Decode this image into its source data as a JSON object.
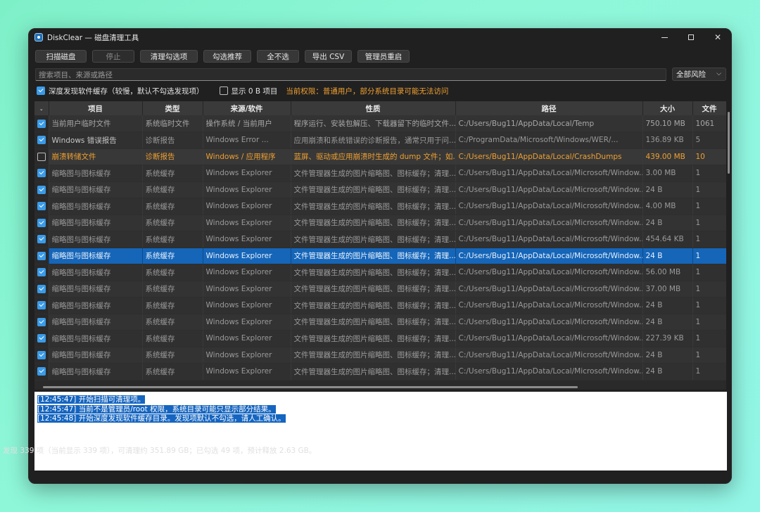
{
  "window": {
    "title": "DiskClear — 磁盘清理工具",
    "controls": {
      "minimize": "minimize-icon",
      "maximize": "maximize-icon",
      "close": "✕"
    }
  },
  "toolbar": {
    "scan": "扫描磁盘",
    "stop": "停止",
    "clean": "清理勾选项",
    "recommend": "勾选推荐",
    "clear_all": "全不选",
    "export_csv": "导出 CSV",
    "admin_restart": "管理员重启"
  },
  "search": {
    "placeholder": "搜索项目、来源或路径",
    "value": ""
  },
  "risk_filter": {
    "selected": "全部风险"
  },
  "options": {
    "deep_scan_label": "深度发现软件缓存（较慢，默认不勾选发现项）",
    "deep_scan_checked": true,
    "show_zero_label": "显示 0 B 项目",
    "show_zero_checked": false,
    "privilege_note": "当前权限：普通用户，部分系统目录可能无法访问"
  },
  "table": {
    "columns": [
      "项目",
      "类型",
      "来源/软件",
      "性质",
      "路径",
      "大小",
      "文件"
    ],
    "rows": [
      {
        "checked": true,
        "name": "当前用户临时文件",
        "type": "系统临时文件",
        "source": "操作系统 / 当前用户",
        "nature": "程序运行、安装包解压、下载器留下的临时文件...",
        "path": "C:/Users/Bug11/AppData/Local/Temp",
        "size": "750.10 MB",
        "files": "1061"
      },
      {
        "checked": true,
        "name": "Windows 错误报告",
        "type": "诊断报告",
        "source": "Windows Error ...",
        "nature": "应用崩溃和系统错误的诊断报告，通常只用于问...",
        "path": "C:/ProgramData/Microsoft/Windows/WER/...",
        "size": "136.89 KB",
        "files": "5"
      },
      {
        "checked": false,
        "name": "崩溃转储文件",
        "type": "诊断报告",
        "source": "Windows / 应用程序",
        "nature": "蓝屏、驱动或应用崩溃时生成的 dump 文件；如...",
        "path": "C:/Users/Bug11/AppData/Local/CrashDumps",
        "size": "439.00 MB",
        "files": "10"
      },
      {
        "checked": true,
        "name": "缩略图与图标缓存",
        "type": "系统缓存",
        "source": "Windows Explorer",
        "nature": "文件管理器生成的图片缩略图、图标缓存；清理...",
        "path": "C:/Users/Bug11/AppData/Local/Microsoft/Window...",
        "size": "3.00 MB",
        "files": "1"
      },
      {
        "checked": true,
        "name": "缩略图与图标缓存",
        "type": "系统缓存",
        "source": "Windows Explorer",
        "nature": "文件管理器生成的图片缩略图、图标缓存；清理...",
        "path": "C:/Users/Bug11/AppData/Local/Microsoft/Window...",
        "size": "24 B",
        "files": "1"
      },
      {
        "checked": true,
        "name": "缩略图与图标缓存",
        "type": "系统缓存",
        "source": "Windows Explorer",
        "nature": "文件管理器生成的图片缩略图、图标缓存；清理...",
        "path": "C:/Users/Bug11/AppData/Local/Microsoft/Window...",
        "size": "4.00 MB",
        "files": "1"
      },
      {
        "checked": true,
        "name": "缩略图与图标缓存",
        "type": "系统缓存",
        "source": "Windows Explorer",
        "nature": "文件管理器生成的图片缩略图、图标缓存；清理...",
        "path": "C:/Users/Bug11/AppData/Local/Microsoft/Window...",
        "size": "24 B",
        "files": "1"
      },
      {
        "checked": true,
        "name": "缩略图与图标缓存",
        "type": "系统缓存",
        "source": "Windows Explorer",
        "nature": "文件管理器生成的图片缩略图、图标缓存；清理...",
        "path": "C:/Users/Bug11/AppData/Local/Microsoft/Window...",
        "size": "454.64 KB",
        "files": "1"
      },
      {
        "checked": true,
        "name": "缩略图与图标缓存",
        "type": "系统缓存",
        "source": "Windows Explorer",
        "nature": "文件管理器生成的图片缩略图、图标缓存；清理...",
        "path": "C:/Users/Bug11/AppData/Local/Microsoft/Window...",
        "size": "24 B",
        "files": "1"
      },
      {
        "checked": true,
        "name": "缩略图与图标缓存",
        "type": "系统缓存",
        "source": "Windows Explorer",
        "nature": "文件管理器生成的图片缩略图、图标缓存；清理...",
        "path": "C:/Users/Bug11/AppData/Local/Microsoft/Window...",
        "size": "56.00 MB",
        "files": "1"
      },
      {
        "checked": true,
        "name": "缩略图与图标缓存",
        "type": "系统缓存",
        "source": "Windows Explorer",
        "nature": "文件管理器生成的图片缩略图、图标缓存；清理...",
        "path": "C:/Users/Bug11/AppData/Local/Microsoft/Window...",
        "size": "37.00 MB",
        "files": "1"
      },
      {
        "checked": true,
        "name": "缩略图与图标缓存",
        "type": "系统缓存",
        "source": "Windows Explorer",
        "nature": "文件管理器生成的图片缩略图、图标缓存；清理...",
        "path": "C:/Users/Bug11/AppData/Local/Microsoft/Window...",
        "size": "24 B",
        "files": "1"
      },
      {
        "checked": true,
        "name": "缩略图与图标缓存",
        "type": "系统缓存",
        "source": "Windows Explorer",
        "nature": "文件管理器生成的图片缩略图、图标缓存；清理...",
        "path": "C:/Users/Bug11/AppData/Local/Microsoft/Window...",
        "size": "24 B",
        "files": "1"
      },
      {
        "checked": true,
        "name": "缩略图与图标缓存",
        "type": "系统缓存",
        "source": "Windows Explorer",
        "nature": "文件管理器生成的图片缩略图、图标缓存；清理...",
        "path": "C:/Users/Bug11/AppData/Local/Microsoft/Window...",
        "size": "227.39 KB",
        "files": "1"
      },
      {
        "checked": true,
        "name": "缩略图与图标缓存",
        "type": "系统缓存",
        "source": "Windows Explorer",
        "nature": "文件管理器生成的图片缩略图、图标缓存；清理...",
        "path": "C:/Users/Bug11/AppData/Local/Microsoft/Window...",
        "size": "24 B",
        "files": "1"
      },
      {
        "checked": true,
        "name": "缩略图与图标缓存",
        "type": "系统缓存",
        "source": "Windows Explorer",
        "nature": "文件管理器生成的图片缩略图、图标缓存；清理...",
        "path": "C:/Users/Bug11/AppData/Local/Microsoft/Window...",
        "size": "24 B",
        "files": "1"
      }
    ]
  },
  "log": {
    "lines": [
      "[12:45:47] 开始扫描可清理项。",
      "[12:45:47] 当前不是管理员/root 权限，系统目录可能只显示部分结果。",
      "[12:45:48] 开始深度发现软件缓存目录。发现项默认不勾选，请人工确认。"
    ]
  },
  "status": "发现 339 项（当前显示 339 项），可清理约 351.89 GB；已勾选 49 项，预计释放 2.63 GB。"
}
